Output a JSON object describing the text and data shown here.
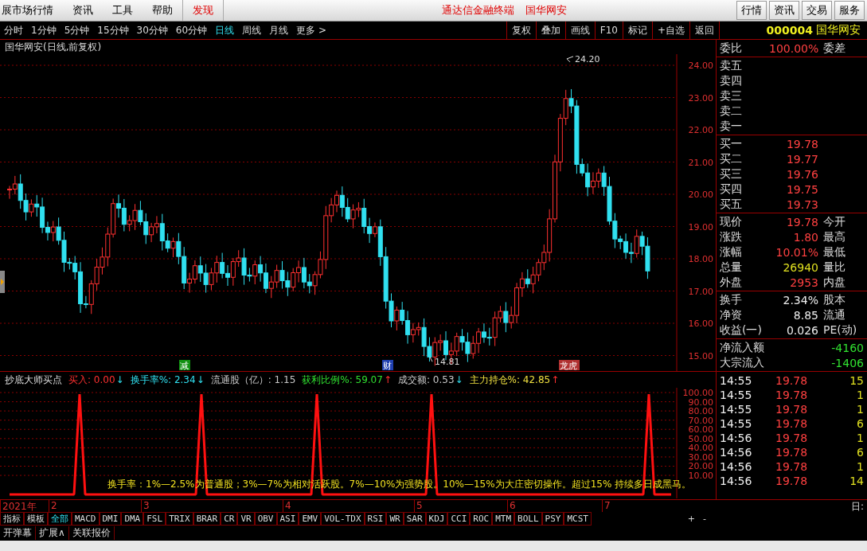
{
  "top_menu": [
    {
      "label": "展市场行情",
      "highlight": false
    },
    {
      "label": "资讯",
      "highlight": false
    },
    {
      "label": "工具",
      "highlight": false
    },
    {
      "label": "帮助",
      "highlight": false
    },
    {
      "label": "发现",
      "highlight": true
    }
  ],
  "center_title": [
    "通达信金融终端",
    "国华网安"
  ],
  "top_buttons": [
    "行情",
    "资讯",
    "交易",
    "服务"
  ],
  "periods": [
    {
      "label": "分时",
      "selected": false
    },
    {
      "label": "1分钟",
      "selected": false
    },
    {
      "label": "5分钟",
      "selected": false
    },
    {
      "label": "15分钟",
      "selected": false
    },
    {
      "label": "30分钟",
      "selected": false
    },
    {
      "label": "60分钟",
      "selected": false
    },
    {
      "label": "日线",
      "selected": true
    },
    {
      "label": "周线",
      "selected": false
    },
    {
      "label": "月线",
      "selected": false
    },
    {
      "label": "更多 >",
      "selected": false
    }
  ],
  "chart_tools": [
    "复权",
    "叠加",
    "画线",
    "F10",
    "标记",
    "+自选",
    "返回"
  ],
  "stock": {
    "code": "000004",
    "name": "国华网安"
  },
  "chart_title": "国华网安(日线,前复权)",
  "price_axis": [
    "24.00",
    "23.00",
    "22.00",
    "21.00",
    "20.00",
    "19.00",
    "18.00",
    "17.00",
    "16.00",
    "15.00"
  ],
  "high_label": "24.20",
  "low_label": "14.81",
  "event_markers": [
    {
      "label": "减",
      "color": "#109010"
    },
    {
      "label": "财",
      "color": "#2040b0"
    },
    {
      "label": "龙虎",
      "color": "#b03030"
    }
  ],
  "indicator": {
    "name": "抄底大师买点",
    "items": [
      {
        "text": "买入: 0.00",
        "arrow": "↓",
        "color": "#ff3030"
      },
      {
        "text": "换手率%: 2.34",
        "arrow": "↓",
        "color": "#30e0f0"
      },
      {
        "text": "流通股（亿）: 1.15",
        "color": "#c8c8c8"
      },
      {
        "text": "获利比例%: 59.07",
        "arrow": "↑",
        "color": "#30e030"
      },
      {
        "text": "成交额: 0.53",
        "arrow": "↓",
        "color": "#c8c8c8"
      },
      {
        "text": "主力持仓%: 42.85",
        "arrow": "↑",
        "color": "#f0e040"
      }
    ]
  },
  "indicator_axis": [
    "100.00",
    "90.00",
    "80.00",
    "70.00",
    "60.00",
    "50.00",
    "40.00",
    "30.00",
    "20.00",
    "10.00"
  ],
  "formula_note": "换手率：1%—2.5%为普通股；3%—7%为相对活跃股。7%—10%为强势股。10%—15%为大庄密切操作。超过15% 持续多日成黑马。",
  "timeline": [
    "2021年",
    "2",
    "3",
    "4",
    "5",
    "6",
    "7"
  ],
  "day_label": "日:",
  "indicator_tabs": [
    {
      "label": "指标",
      "selected": false
    },
    {
      "label": "模板",
      "selected": false
    },
    {
      "label": "全部",
      "selected": true
    },
    {
      "label": "MACD",
      "selected": false
    },
    {
      "label": "DMI",
      "selected": false
    },
    {
      "label": "DMA",
      "selected": false
    },
    {
      "label": "FSL",
      "selected": false
    },
    {
      "label": "TRIX",
      "selected": false
    },
    {
      "label": "BRAR",
      "selected": false
    },
    {
      "label": "CR",
      "selected": false
    },
    {
      "label": "VR",
      "selected": false
    },
    {
      "label": "OBV",
      "selected": false
    },
    {
      "label": "ASI",
      "selected": false
    },
    {
      "label": "EMV",
      "selected": false
    },
    {
      "label": "VOL-TDX",
      "selected": false
    },
    {
      "label": "RSI",
      "selected": false
    },
    {
      "label": "WR",
      "selected": false
    },
    {
      "label": "SAR",
      "selected": false
    },
    {
      "label": "KDJ",
      "selected": false
    },
    {
      "label": "CCI",
      "selected": false
    },
    {
      "label": "ROC",
      "selected": false
    },
    {
      "label": "MTM",
      "selected": false
    },
    {
      "label": "BOLL",
      "selected": false
    },
    {
      "label": "PSY",
      "selected": false
    },
    {
      "label": "MCST",
      "selected": false
    }
  ],
  "zoom_buttons": [
    "+",
    "-"
  ],
  "bottom_tabs": [
    "开弹幕",
    "扩展∧",
    "关联报价"
  ],
  "order_ratio": {
    "label": "委比",
    "value": "100.00%",
    "label2": "委差"
  },
  "sell_levels": [
    "卖五",
    "卖四",
    "卖三",
    "卖二",
    "卖一"
  ],
  "buy_levels": [
    {
      "label": "买一",
      "price": "19.78"
    },
    {
      "label": "买二",
      "price": "19.77"
    },
    {
      "label": "买三",
      "price": "19.76"
    },
    {
      "label": "买四",
      "price": "19.75"
    },
    {
      "label": "买五",
      "price": "19.73"
    }
  ],
  "quote": [
    {
      "label": "现价",
      "value": "19.78",
      "label2": "今开",
      "color": "#ff4040"
    },
    {
      "label": "涨跌",
      "value": "1.80",
      "label2": "最高",
      "color": "#ff4040"
    },
    {
      "label": "涨幅",
      "value": "10.01%",
      "label2": "最低",
      "color": "#ff4040"
    },
    {
      "label": "总量",
      "value": "26940",
      "label2": "量比",
      "color": "#e0e020"
    },
    {
      "label": "外盘",
      "value": "2953",
      "label2": "内盘",
      "color": "#ff4040"
    }
  ],
  "fundamentals": [
    {
      "label": "换手",
      "value": "2.34%",
      "label2": "股本"
    },
    {
      "label": "净资",
      "value": "8.85",
      "label2": "流通"
    },
    {
      "label": "收益(一)",
      "value": "0.026",
      "label2": "PE(动)"
    }
  ],
  "flows": [
    {
      "label": "净流入额",
      "value": "-4160"
    },
    {
      "label": "大宗流入",
      "value": "-1406"
    }
  ],
  "ticks": [
    {
      "time": "14:55",
      "price": "19.78",
      "volume": "15"
    },
    {
      "time": "14:55",
      "price": "19.78",
      "volume": "1"
    },
    {
      "time": "14:55",
      "price": "19.78",
      "volume": "1"
    },
    {
      "time": "14:55",
      "price": "19.78",
      "volume": "6"
    },
    {
      "time": "14:56",
      "price": "19.78",
      "volume": "1"
    },
    {
      "time": "14:56",
      "price": "19.78",
      "volume": "6"
    },
    {
      "time": "14:56",
      "price": "19.78",
      "volume": "1"
    },
    {
      "time": "14:56",
      "price": "19.78",
      "volume": "14"
    }
  ]
}
